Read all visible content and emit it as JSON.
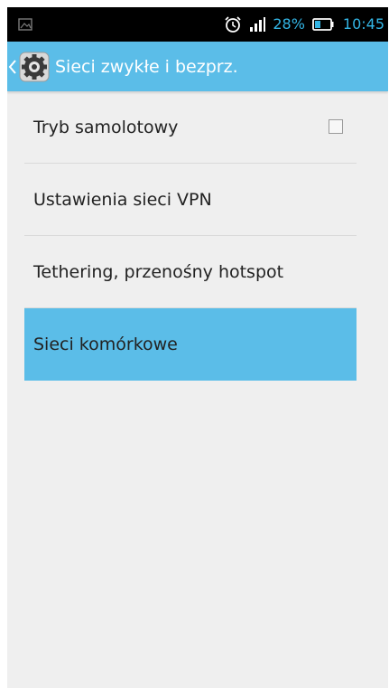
{
  "status_bar": {
    "left_icon": "image-notification-icon",
    "alarm_icon": "alarm-clock-icon",
    "signal_icon": "signal-strength-icon",
    "battery_percent": "28%",
    "battery_icon": "battery-icon",
    "time": "10:45",
    "accent_color": "#33b5e5"
  },
  "action_bar": {
    "title": "Sieci zwykłe i bezprz.",
    "app_icon": "settings-gear-icon",
    "back_icon": "chevron-left-icon",
    "color": "#5bbde8"
  },
  "settings": {
    "items": [
      {
        "label": "Tryb samolotowy",
        "has_checkbox": true,
        "checked": false
      },
      {
        "label": "Ustawienia sieci VPN"
      },
      {
        "label": "Tethering, przenośny hotspot"
      },
      {
        "label": "Sieci komórkowe",
        "selected": true
      }
    ]
  }
}
